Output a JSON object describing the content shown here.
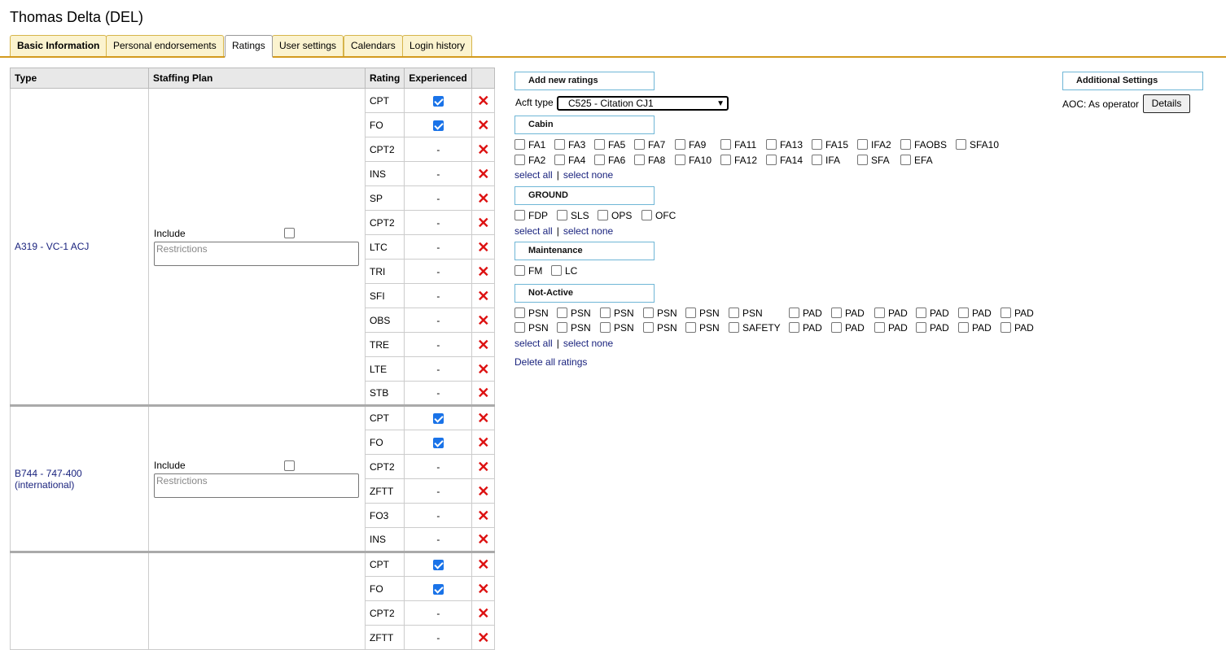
{
  "page": {
    "title": "Thomas Delta (DEL)"
  },
  "tabs": [
    {
      "label": "Basic Information"
    },
    {
      "label": "Personal endorsements"
    },
    {
      "label": "Ratings"
    },
    {
      "label": "User settings"
    },
    {
      "label": "Calendars"
    },
    {
      "label": "Login history"
    }
  ],
  "table": {
    "headers": {
      "type": "Type",
      "staffing": "Staffing Plan",
      "rating": "Rating",
      "experienced": "Experienced"
    },
    "include_label": "Include",
    "restrictions_placeholder": "Restrictions",
    "not_experienced": "-",
    "groups": [
      {
        "type": "A319 - VC-1 ACJ",
        "ratings": [
          {
            "rating": "CPT",
            "experienced": true
          },
          {
            "rating": "FO",
            "experienced": true
          },
          {
            "rating": "CPT2",
            "experienced": false
          },
          {
            "rating": "INS",
            "experienced": false
          },
          {
            "rating": "SP",
            "experienced": false
          },
          {
            "rating": "CPT2",
            "experienced": false
          },
          {
            "rating": "LTC",
            "experienced": false
          },
          {
            "rating": "TRI",
            "experienced": false
          },
          {
            "rating": "SFI",
            "experienced": false
          },
          {
            "rating": "OBS",
            "experienced": false
          },
          {
            "rating": "TRE",
            "experienced": false
          },
          {
            "rating": "LTE",
            "experienced": false
          },
          {
            "rating": "STB",
            "experienced": false
          }
        ]
      },
      {
        "type": "B744 - 747-400 (international)",
        "ratings": [
          {
            "rating": "CPT",
            "experienced": true
          },
          {
            "rating": "FO",
            "experienced": true
          },
          {
            "rating": "CPT2",
            "experienced": false
          },
          {
            "rating": "ZFTT",
            "experienced": false
          },
          {
            "rating": "FO3",
            "experienced": false
          },
          {
            "rating": "INS",
            "experienced": false
          }
        ]
      },
      {
        "type": "",
        "ratings": [
          {
            "rating": "CPT",
            "experienced": true
          },
          {
            "rating": "FO",
            "experienced": true
          },
          {
            "rating": "CPT2",
            "experienced": false
          },
          {
            "rating": "ZFTT",
            "experienced": false
          }
        ]
      }
    ]
  },
  "add_ratings": {
    "header": "Add new ratings",
    "acft_type_label": "Acft type",
    "acft_type_value": "C525 - Citation CJ1",
    "select_all": "select all",
    "select_none": "select none",
    "separator": "|",
    "delete_all": "Delete all ratings",
    "sections": [
      {
        "name": "Cabin",
        "rows": [
          [
            "FA1",
            "FA3",
            "FA5",
            "FA7",
            "FA9",
            "FA11",
            "FA13",
            "FA15",
            "IFA2",
            "FAOBS",
            "SFA10"
          ],
          [
            "FA2",
            "FA4",
            "FA6",
            "FA8",
            "FA10",
            "FA12",
            "FA14",
            "IFA",
            "SFA",
            "EFA"
          ]
        ]
      },
      {
        "name": "GROUND",
        "rows": [
          [
            "FDP",
            "SLS",
            "OPS",
            "OFC"
          ]
        ]
      },
      {
        "name": "Maintenance",
        "rows": [
          [
            "FM",
            "LC"
          ]
        ]
      },
      {
        "name": "Not-Active",
        "rows": [
          [
            "PSN",
            "PSN",
            "PSN",
            "PSN",
            "PSN",
            "PSN",
            "PAD",
            "PAD",
            "PAD",
            "PAD",
            "PAD",
            "PAD"
          ],
          [
            "PSN",
            "PSN",
            "PSN",
            "PSN",
            "PSN",
            "SAFETY",
            "PAD",
            "PAD",
            "PAD",
            "PAD",
            "PAD",
            "PAD"
          ]
        ]
      }
    ]
  },
  "additional": {
    "header": "Additional Settings",
    "aoc_label": "AOC: As operator",
    "details_button": "Details"
  }
}
